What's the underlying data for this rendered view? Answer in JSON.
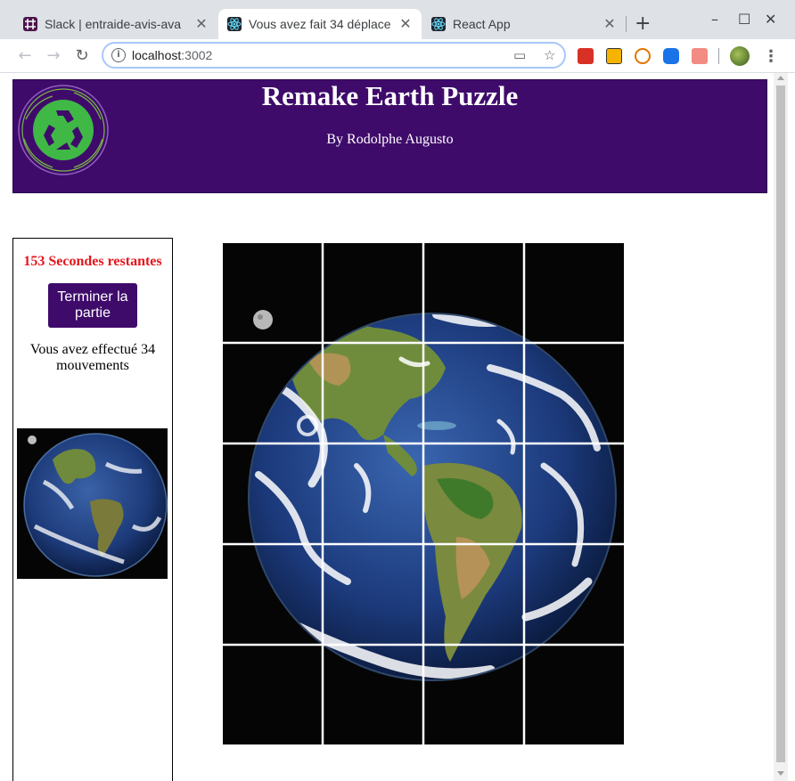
{
  "browser": {
    "tabs": [
      {
        "title": "Slack | entraide-avis-ava",
        "active": false
      },
      {
        "title": "Vous avez fait 34 déplace",
        "active": true
      },
      {
        "title": "React App",
        "active": false
      }
    ],
    "new_tab_symbol": "+",
    "window_controls": [
      "–",
      "☐",
      "✕"
    ],
    "url_host": "localhost",
    "url_port": ":3002",
    "extensions": [
      "ext-red-icon",
      "ext-yellow-icon",
      "ext-play-icon",
      "ext-blue-icon",
      "ext-doc-icon",
      "ext-react-icon",
      "profile-avatar"
    ],
    "accent": "#a8c7fa"
  },
  "header": {
    "title": "Remake Earth Puzzle",
    "byline": "By Rodolphe Augusto",
    "background": "#3f0b6b",
    "logo": "recycle-earth-logo"
  },
  "sidebar": {
    "timer_text": "153 Secondes restantes",
    "timer_color": "#e4161c",
    "end_button": "Terminer la partie",
    "moves_text": "Vous avez effectué 34 mouvements",
    "preview": "earth-preview-image"
  },
  "puzzle": {
    "rows": 5,
    "cols": 4,
    "image": "earth-from-space"
  }
}
